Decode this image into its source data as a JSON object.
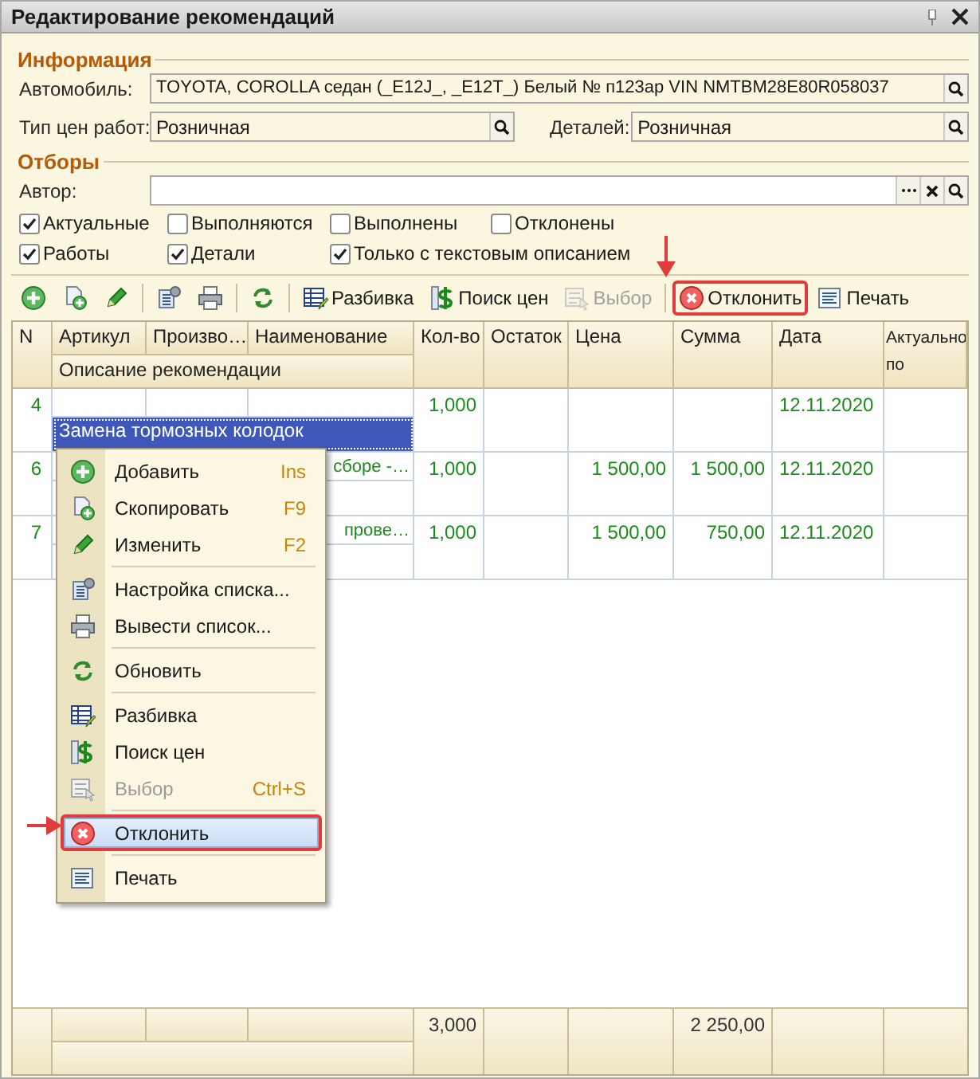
{
  "window": {
    "title": "Редактирование рекомендаций"
  },
  "info": {
    "heading": "Информация",
    "car": {
      "label": "Автомобиль:",
      "value": "TOYOTA, COROLLA седан (_E12J_, _E12T_) Белый № п123ар VIN NMTBM28E80R058037"
    },
    "work_prices": {
      "label": "Тип цен работ:",
      "value": "Розничная"
    },
    "part_prices": {
      "label": "Деталей:",
      "value": "Розничная"
    }
  },
  "filters": {
    "heading": "Отборы",
    "author": {
      "label": "Автор:"
    },
    "checkboxes": [
      {
        "label": "Актуальные",
        "checked": true
      },
      {
        "label": "Выполняются",
        "checked": false
      },
      {
        "label": "Выполнены",
        "checked": false
      },
      {
        "label": "Отклонены",
        "checked": false
      },
      {
        "label": "Работы",
        "checked": true
      },
      {
        "label": "Детали",
        "checked": true
      },
      {
        "label": "Только с текстовым описанием",
        "checked": true
      }
    ]
  },
  "toolbar": [
    {
      "kind": "button",
      "disabled": false,
      "highlighted": false
    },
    {
      "kind": "button",
      "disabled": false,
      "highlighted": false
    },
    {
      "kind": "button",
      "disabled": false,
      "highlighted": false
    },
    {
      "kind": "separator"
    },
    {
      "kind": "button",
      "disabled": false,
      "highlighted": false
    },
    {
      "kind": "button",
      "disabled": false,
      "highlighted": false
    },
    {
      "kind": "separator"
    },
    {
      "kind": "button",
      "disabled": false,
      "highlighted": false
    },
    {
      "kind": "separator"
    },
    {
      "kind": "button",
      "label": "Разбивка",
      "disabled": false,
      "highlighted": false
    },
    {
      "kind": "button",
      "label": "Поиск цен",
      "disabled": false,
      "highlighted": false
    },
    {
      "kind": "button",
      "label": "Выбор",
      "disabled": true,
      "highlighted": false
    },
    {
      "kind": "separator"
    },
    {
      "kind": "button",
      "label": "Отклонить",
      "disabled": false,
      "highlighted": true
    },
    {
      "kind": "button",
      "label": "Печать",
      "disabled": false,
      "highlighted": false
    }
  ],
  "table": {
    "columns": [
      "N",
      "Артикул",
      "Произво…",
      "Наименование",
      "Кол-во",
      "Остаток",
      "Цена",
      "Сумма",
      "Дата",
      "Актуально по"
    ],
    "description_column": "Описание рекомендации",
    "rows": [
      {
        "n": "4",
        "name": "",
        "qty": "1,000",
        "price": "",
        "sum": "",
        "date": "12.11.2020",
        "description": "Замена тормозных колодок",
        "selected": true
      },
      {
        "n": "6",
        "name": "сборе -…",
        "qty": "1,000",
        "price": "1 500,00",
        "sum": "1 500,00",
        "date": "12.11.2020",
        "description": "",
        "selected": false
      },
      {
        "n": "7",
        "name": "прове…",
        "qty": "1,000",
        "price": "1 500,00",
        "sum": "750,00",
        "date": "12.11.2020",
        "description": "",
        "selected": false
      }
    ],
    "totals": {
      "qty": "3,000",
      "sum": "2 250,00"
    }
  },
  "context_menu": {
    "items": [
      {
        "kind": "item",
        "label": "Добавить",
        "shortcut": "Ins",
        "disabled": false,
        "selected": false,
        "highlighted": false
      },
      {
        "kind": "item",
        "label": "Скопировать",
        "shortcut": "F9",
        "disabled": false,
        "selected": false,
        "highlighted": false
      },
      {
        "kind": "item",
        "label": "Изменить",
        "shortcut": "F2",
        "disabled": false,
        "selected": false,
        "highlighted": false
      },
      {
        "kind": "separator"
      },
      {
        "kind": "item",
        "label": "Настройка списка...",
        "disabled": false,
        "selected": false,
        "highlighted": false
      },
      {
        "kind": "item",
        "label": "Вывести список...",
        "disabled": false,
        "selected": false,
        "highlighted": false
      },
      {
        "kind": "separator"
      },
      {
        "kind": "item",
        "label": "Обновить",
        "disabled": false,
        "selected": false,
        "highlighted": false
      },
      {
        "kind": "separator"
      },
      {
        "kind": "item",
        "label": "Разбивка",
        "disabled": false,
        "selected": false,
        "highlighted": false
      },
      {
        "kind": "item",
        "label": "Поиск цен",
        "disabled": false,
        "selected": false,
        "highlighted": false
      },
      {
        "kind": "item",
        "label": "Выбор",
        "shortcut": "Ctrl+S",
        "disabled": true,
        "selected": false,
        "highlighted": false
      },
      {
        "kind": "separator"
      },
      {
        "kind": "item",
        "label": "Отклонить",
        "disabled": false,
        "selected": true,
        "highlighted": true
      },
      {
        "kind": "separator"
      },
      {
        "kind": "item",
        "label": "Печать",
        "disabled": false,
        "selected": false,
        "highlighted": false
      }
    ]
  }
}
